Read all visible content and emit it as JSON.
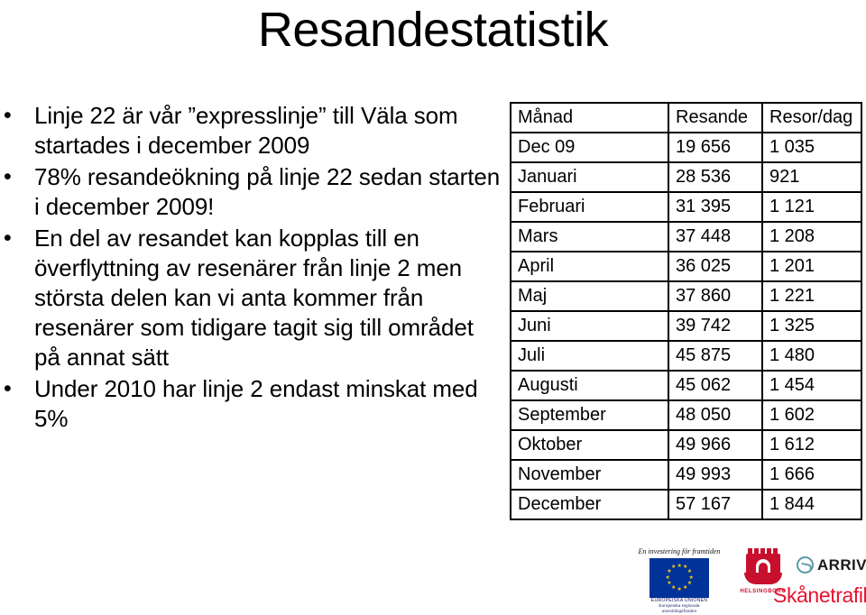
{
  "slide": {
    "title": "Resandestatistik"
  },
  "bullets": [
    {
      "marker": "•",
      "text": "Linje 22 är vår ”expresslinje” till Väla som startades i december 2009"
    },
    {
      "marker": "•",
      "text": "78% resandeökning på linje 22 sedan starten i december 2009!"
    },
    {
      "marker": "•",
      "text": "En del av resandet kan kopplas till en överflyttning av resenärer från linje 2 men största delen kan vi anta kommer från resenärer som tidigare tagit sig till området på annat sätt"
    },
    {
      "marker": "•",
      "text": "Under 2010 har linje 2 endast minskat med 5%"
    }
  ],
  "table": {
    "headers": [
      "Månad",
      "Resande",
      "Resor/dag"
    ],
    "rows": [
      {
        "month": "Dec 09",
        "resande": "19 656",
        "resor_dag": "1 035"
      },
      {
        "month": "Januari",
        "resande": "28 536",
        "resor_dag": "921"
      },
      {
        "month": "Februari",
        "resande": "31 395",
        "resor_dag": "1 121"
      },
      {
        "month": "Mars",
        "resande": "37 448",
        "resor_dag": "1 208"
      },
      {
        "month": "April",
        "resande": "36 025",
        "resor_dag": "1 201"
      },
      {
        "month": "Maj",
        "resande": "37 860",
        "resor_dag": "1 221"
      },
      {
        "month": "Juni",
        "resande": "39 742",
        "resor_dag": "1 325"
      },
      {
        "month": "Juli",
        "resande": "45 875",
        "resor_dag": "1 480"
      },
      {
        "month": "Augusti",
        "resande": "45 062",
        "resor_dag": "1 454"
      },
      {
        "month": "September",
        "resande": "48 050",
        "resor_dag": "1 602"
      },
      {
        "month": "Oktober",
        "resande": "49 966",
        "resor_dag": "1 612"
      },
      {
        "month": "November",
        "resande": "49 993",
        "resor_dag": "1 666"
      },
      {
        "month": "December",
        "resande": "57 167",
        "resor_dag": "1 844"
      }
    ]
  },
  "footer": {
    "eu": {
      "tagline": "En investering för framtiden",
      "caption_line1": "EUROPEISKA UNIONEN",
      "caption_line2": "Europeiska regionala",
      "caption_line3": "utvecklingsfonden",
      "flag_color": "#003399",
      "star_color": "#FFCC00"
    },
    "helsingborg": {
      "name": "HELSINGBORG",
      "color": "#c8102e"
    },
    "arriva": {
      "wordmark": "ARRIVA",
      "mark_color": "#5d9aa8",
      "text_color": "#1a1a1a"
    },
    "skanetrafiken": {
      "wordmark": "Skånetrafiken",
      "color": "#e8112d"
    }
  }
}
